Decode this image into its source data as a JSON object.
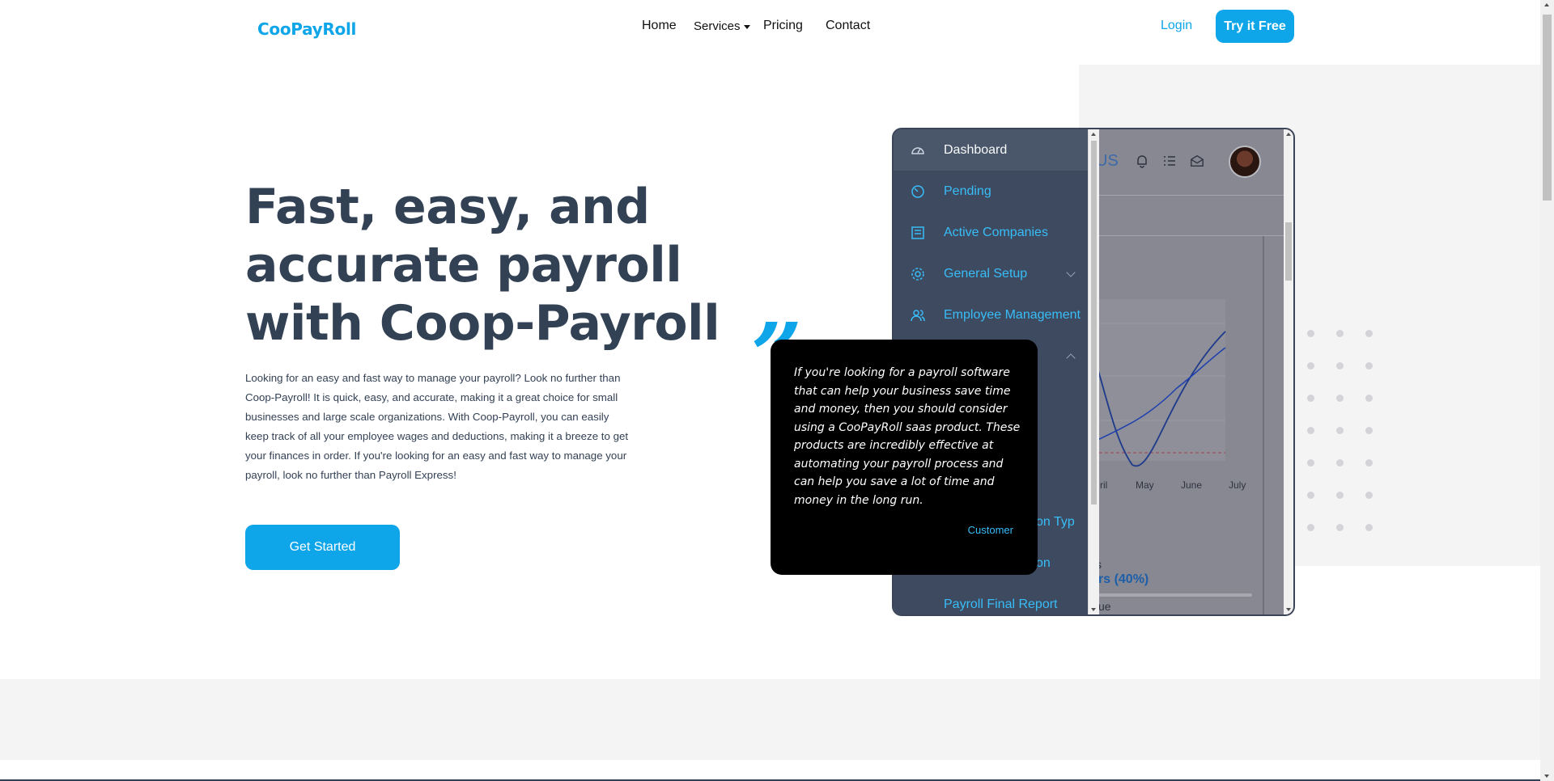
{
  "brand": "CooPayRoll",
  "nav": {
    "home": "Home",
    "services": "Services",
    "pricing": "Pricing",
    "contact": "Contact",
    "login": "Login",
    "try_free": "Try it Free"
  },
  "hero": {
    "title": "Fast, easy, and accurate payroll with Coop-Payroll",
    "description": "Looking for an easy and fast way to manage your payroll? Look no further than Coop-Payroll! It is quick, easy, and accurate, making it a great choice for small businesses and large scale organizations. With Coop-Payroll, you can easily keep track of all your employee wages and deductions, making it a breeze to get your finances in order. If you're looking for an easy and fast way to manage your payroll, look no further than Payroll Express!",
    "cta": "Get Started"
  },
  "dashboard_mock": {
    "topbar_text": "US",
    "sidebar": [
      {
        "label": "Dashboard",
        "icon": "dashboard-gauge-icon",
        "active": true
      },
      {
        "label": "Pending",
        "icon": "pending-icon",
        "active": false
      },
      {
        "label": "Active Companies",
        "icon": "companies-icon",
        "active": false
      },
      {
        "label": "General Setup",
        "icon": "gear-icon",
        "active": false,
        "chevron": "down"
      },
      {
        "label": "Employee Management",
        "icon": "employees-icon",
        "active": false
      },
      {
        "label": "",
        "icon": "",
        "active": false,
        "chevron": "up"
      },
      {
        "label": "ction Typ",
        "icon": "",
        "active": false
      },
      {
        "label": "ction",
        "icon": "",
        "active": false
      },
      {
        "label": "Payroll Final Report",
        "icon": "",
        "active": false
      }
    ],
    "chart_months": [
      "ril",
      "May",
      "June",
      "July"
    ],
    "stat_partial": "s",
    "stat_highlight": "rs (40%)",
    "stat_bottom": "ue"
  },
  "quote": {
    "text": "If you're looking for a payroll software that can help your business save time and money, then you should consider using a CooPayRoll saas product. These products are incredibly effective at automating your payroll process and can help you save a lot of time and money in the long run.",
    "author": "Customer",
    "mark": "”"
  },
  "colors": {
    "brand": "#0ea5e9",
    "heading": "#334155",
    "sidebar_bg": "#3d4a5f",
    "quote_bg": "#000000"
  }
}
